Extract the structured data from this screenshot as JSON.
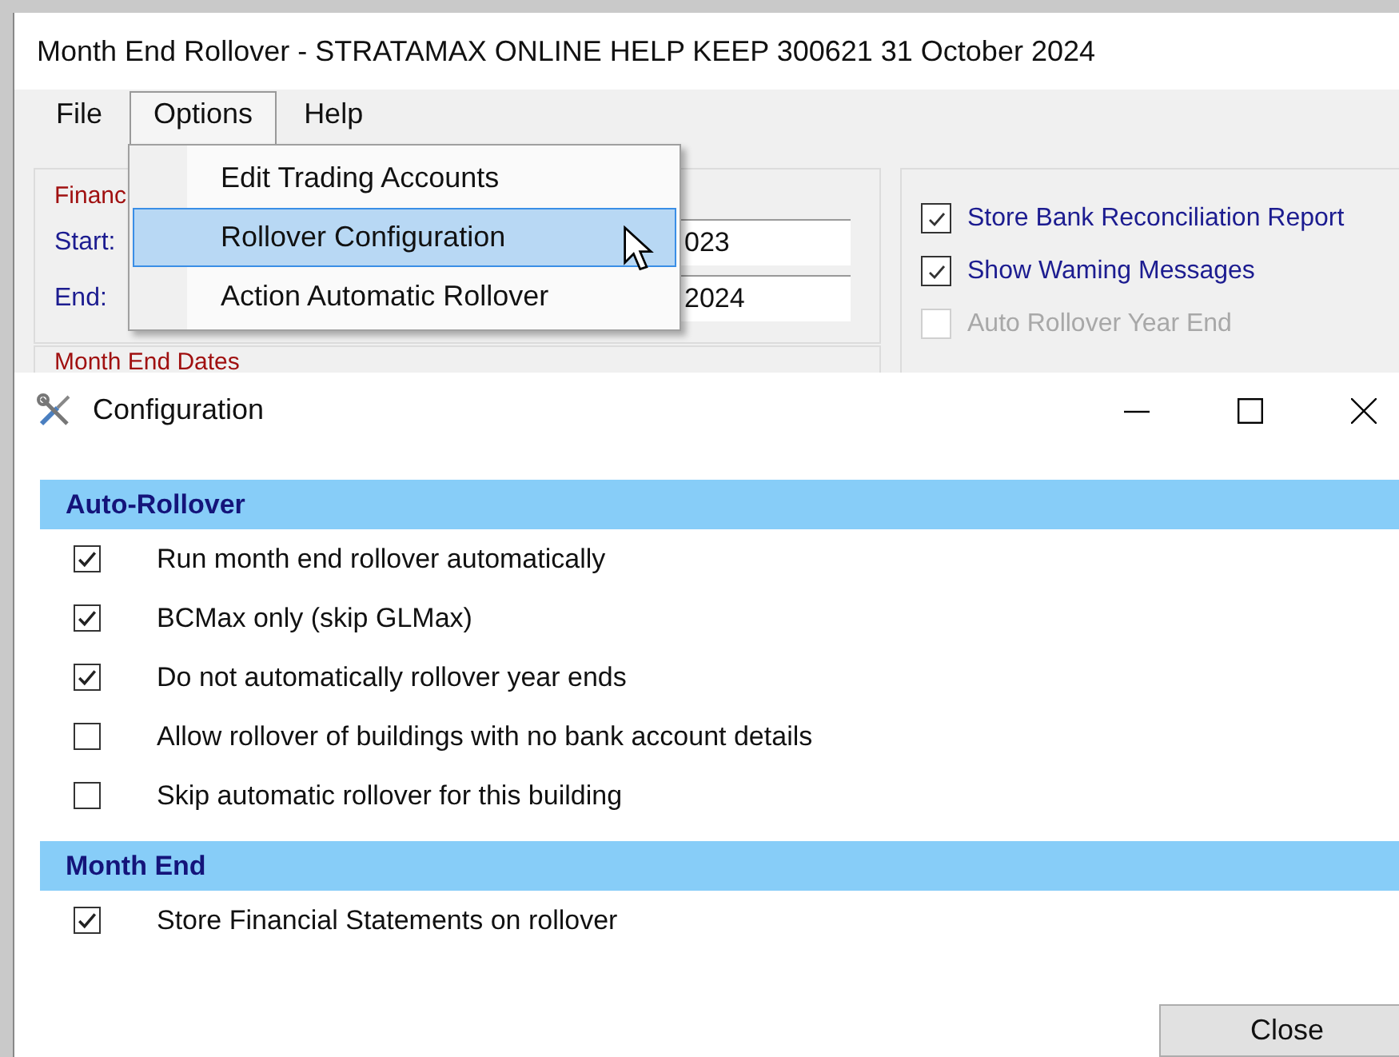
{
  "main_window": {
    "title": "Month End Rollover - STRATAMAX ONLINE HELP KEEP 300621 31 October 2024",
    "menu": [
      {
        "label": "File",
        "selected": false
      },
      {
        "label": "Options",
        "selected": true
      },
      {
        "label": "Help",
        "selected": false
      }
    ],
    "options_menu": [
      {
        "label": "Edit Trading Accounts",
        "selected": false
      },
      {
        "label": "Rollover Configuration",
        "selected": true
      },
      {
        "label": "Action Automatic Rollover",
        "selected": false
      }
    ],
    "financial_group": {
      "title": "Financ",
      "start_label": "Start:",
      "start_value": "023",
      "end_label": "End:",
      "end_value": "2024"
    },
    "month_end_dates_group": {
      "title": "Month End Dates"
    },
    "options": [
      {
        "label": "Store Bank Reconciliation Report",
        "checked": true,
        "disabled": false
      },
      {
        "label": "Show Waming Messages",
        "checked": true,
        "disabled": false
      },
      {
        "label": "Auto Rollover Year End",
        "checked": false,
        "disabled": true
      }
    ]
  },
  "config_window": {
    "title": "Configuration",
    "sections": [
      {
        "title": "Auto-Rollover",
        "items": [
          {
            "label": "Run month end rollover automatically",
            "checked": true
          },
          {
            "label": "BCMax only (skip GLMax)",
            "checked": true
          },
          {
            "label": "Do not automatically rollover year ends",
            "checked": true
          },
          {
            "label": "Allow rollover of buildings with no bank account details",
            "checked": false
          },
          {
            "label": "Skip automatic rollover for this building",
            "checked": false
          }
        ]
      },
      {
        "title": "Month End",
        "items": [
          {
            "label": "Store Financial Statements on rollover",
            "checked": true
          }
        ]
      }
    ],
    "close_button": "Close"
  }
}
